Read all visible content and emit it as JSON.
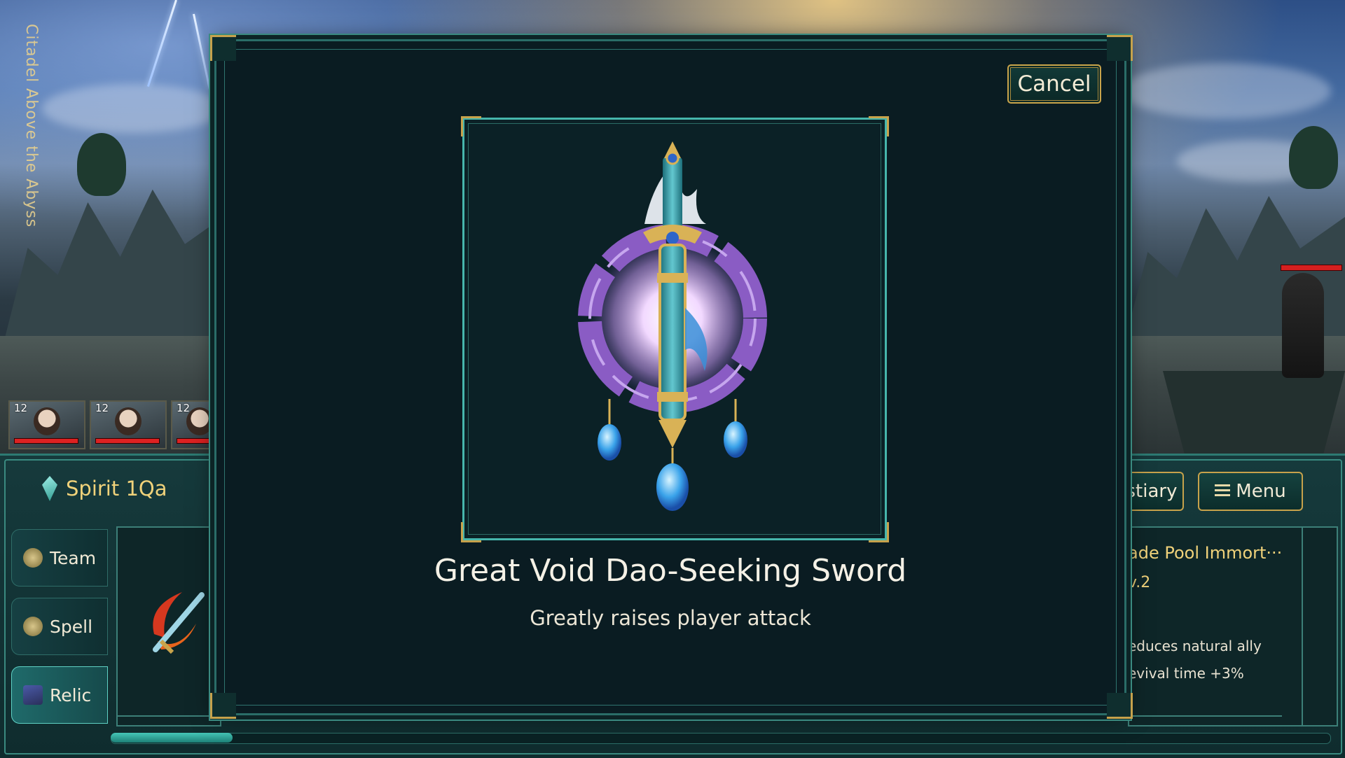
{
  "location": {
    "title": "Citadel Above the Abyss"
  },
  "party": [
    {
      "level": "12"
    },
    {
      "level": "12"
    },
    {
      "level": "12"
    }
  ],
  "resources": {
    "spirit_label": "Spirit 1Qa"
  },
  "side_tabs": [
    {
      "label": "Team",
      "icon": "team-icon"
    },
    {
      "label": "Spell",
      "icon": "spell-icon"
    },
    {
      "label": "Relic",
      "icon": "relic-icon",
      "active": true
    }
  ],
  "top_right": {
    "bestiary_label": "stiary",
    "menu_label": "Menu"
  },
  "relic_info": {
    "name": "ade Pool Immort···",
    "level": "v.2",
    "desc_line1": "educes natural ally",
    "desc_line2": "evival time  +3%"
  },
  "progress": {
    "value": 0.1
  },
  "modal": {
    "cancel_label": "Cancel",
    "item_name": "Great Void Dao-Seeking Sword",
    "item_desc": "Greatly raises player attack"
  },
  "colors": {
    "accent_gold": "#c9a44b",
    "frame_teal": "#46b6ac",
    "panel_bg": "#0a1c22",
    "resource_gold": "#f0d27a",
    "hp_red": "#d52020"
  }
}
